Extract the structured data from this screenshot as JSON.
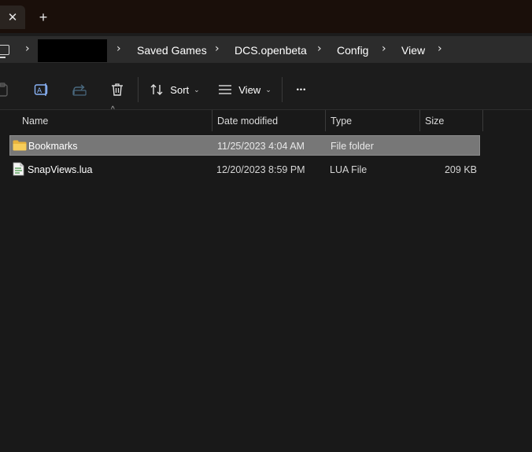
{
  "tabbar": {
    "close_glyph": "✕",
    "new_tab_glyph": "+"
  },
  "address": {
    "sep": "›",
    "crumbs": [
      "Saved Games",
      "DCS.openbeta",
      "Config",
      "View"
    ]
  },
  "toolbar": {
    "sort_label": "Sort",
    "view_label": "View",
    "chevron": "⌄",
    "more_glyph": "•••"
  },
  "columns": {
    "name": "Name",
    "date": "Date modified",
    "type": "Type",
    "size": "Size",
    "sort_indicator": "^"
  },
  "files": [
    {
      "name": "Bookmarks",
      "date": "11/25/2023 4:04 AM",
      "type": "File folder",
      "size": "",
      "icon": "folder-icon",
      "selected": true
    },
    {
      "name": "SnapViews.lua",
      "date": "12/20/2023 8:59 PM",
      "type": "LUA File",
      "size": "209 KB",
      "icon": "lua-file-icon",
      "selected": false
    }
  ],
  "colors": {
    "titlebar": "#1a0f0a",
    "addressbar": "#2c2c2c",
    "background": "#191919",
    "selected_row": "#777777",
    "folder": "#f2c14e"
  }
}
